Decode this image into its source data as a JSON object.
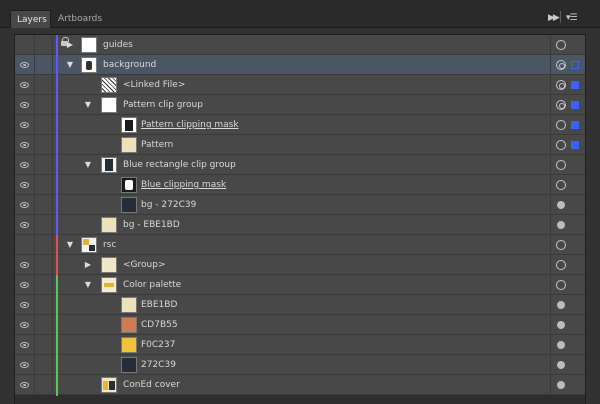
{
  "tabs": [
    {
      "label": "Layers",
      "active": true
    },
    {
      "label": "Artboards",
      "active": false
    }
  ],
  "panel_controls": {
    "collapse_icon": "double-chevron-right-icon",
    "menu_icon": "panel-menu-icon"
  },
  "colors": {
    "blue_layer": "#5a5aff",
    "red_layer": "#e05050",
    "green_layer": "#55c855",
    "selection": "#3a62ff"
  },
  "rows": [
    {
      "name": "guides",
      "visible": false,
      "locked": true,
      "expanded": false,
      "thumb": "white"
    },
    {
      "name": "background",
      "visible": true,
      "locked": false,
      "expanded": true,
      "thumb": "bgart",
      "selected": true
    },
    {
      "name": "<Linked File>",
      "visible": true,
      "thumb": "linked"
    },
    {
      "name": "Pattern clip group",
      "visible": true,
      "expanded": true,
      "thumb": "white"
    },
    {
      "name": "Pattern clipping mask",
      "visible": true,
      "thumb": "maskb",
      "mask": true
    },
    {
      "name": "Pattern",
      "visible": true,
      "thumb": "cream"
    },
    {
      "name": "Blue rectangle clip group",
      "visible": true,
      "expanded": true,
      "thumb": "navyframe"
    },
    {
      "name": "Blue clipping mask",
      "visible": true,
      "thumb": "maskw",
      "mask": true
    },
    {
      "name": "bg - 272C39",
      "visible": true,
      "thumb": "navy"
    },
    {
      "name": "bg - EBE1BD",
      "visible": true,
      "thumb": "cream"
    },
    {
      "name": "rsc",
      "visible": false,
      "expanded": true,
      "thumb": "rscart"
    },
    {
      "name": "<Group>",
      "visible": true,
      "expanded": false,
      "thumb": "grp"
    },
    {
      "name": "Color palette",
      "visible": true,
      "expanded": true,
      "thumb": "palette"
    },
    {
      "name": "EBE1BD",
      "visible": true,
      "thumb": "cream"
    },
    {
      "name": "CD7B55",
      "visible": true,
      "thumb": "rust"
    },
    {
      "name": "F0C237",
      "visible": true,
      "thumb": "gold"
    },
    {
      "name": "272C39",
      "visible": true,
      "thumb": "navy"
    },
    {
      "name": "ConEd cover",
      "visible": true,
      "thumb": "coned"
    }
  ]
}
